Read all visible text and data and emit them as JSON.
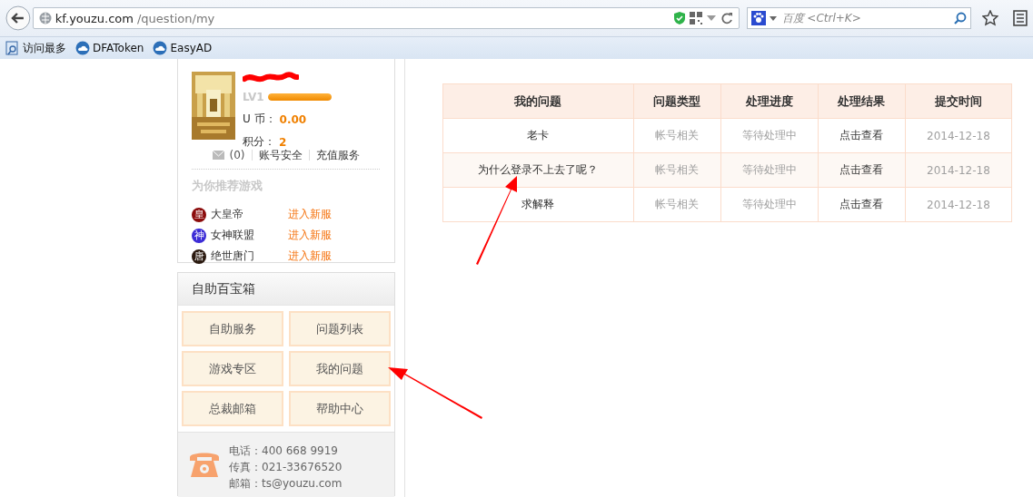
{
  "browser": {
    "url_host": "kf.youzu.com",
    "url_path": "/question/my",
    "search_placeholder": "百度 <Ctrl+K>",
    "bookmarks": [
      {
        "kind": "most-visited",
        "label": "访问最多"
      },
      {
        "kind": "site",
        "label": "DFAToken"
      },
      {
        "kind": "site",
        "label": "EasyAD"
      }
    ]
  },
  "profile": {
    "level_label": "LV1",
    "level": 1,
    "coins_label": "U 币：",
    "coins": "0.00",
    "points_label": "积分：",
    "points": "2",
    "messages": "(0)",
    "links": [
      "账号安全",
      "充值服务"
    ],
    "recommend_title": "为你推荐游戏",
    "games": [
      {
        "badge": "皇",
        "name": "大皇帝",
        "color": "#8b0b0b",
        "action": "进入新服"
      },
      {
        "badge": "神",
        "name": "女神联盟",
        "color": "#3b2bd6",
        "action": "进入新服"
      },
      {
        "badge": "唐",
        "name": "绝世唐门",
        "color": "#2b1a10",
        "action": "进入新服"
      }
    ]
  },
  "toolbox": {
    "title": "自助百宝箱",
    "buttons": [
      "自助服务",
      "问题列表",
      "游戏专区",
      "我的问题",
      "总裁邮箱",
      "帮助中心"
    ],
    "contact": [
      {
        "label": "电话：",
        "value": "400 668 9919"
      },
      {
        "label": "传真：",
        "value": "021-33676520"
      },
      {
        "label": "邮箱：",
        "value": "ts@youzu.com"
      }
    ]
  },
  "table": {
    "columns": [
      "我的问题",
      "问题类型",
      "处理进度",
      "处理结果",
      "提交时间"
    ],
    "rows": [
      {
        "cells": [
          "老卡",
          "帐号相关",
          "等待处理中",
          "点击查看",
          "2014-12-18"
        ]
      },
      {
        "cells": [
          "为什么登录不上去了呢？",
          "帐号相关",
          "等待处理中",
          "点击查看",
          "2014-12-18"
        ]
      },
      {
        "cells": [
          "求解释",
          "帐号相关",
          "等待处理中",
          "点击查看",
          "2014-12-18"
        ]
      }
    ]
  }
}
